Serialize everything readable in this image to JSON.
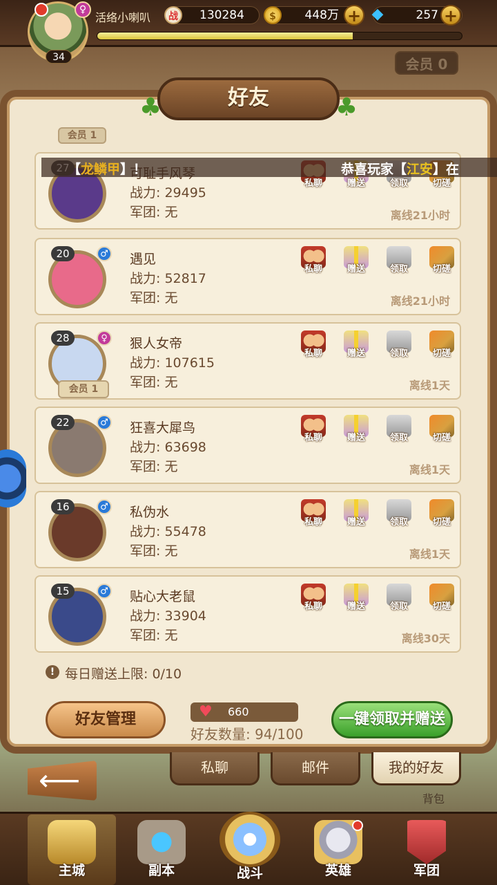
{
  "header": {
    "player_name": "活络小喇叭",
    "level": "34",
    "gender_symbol": "♀",
    "power_icon": "战",
    "power": "130284",
    "gold": "448万",
    "gems": "257",
    "plus_symbol": "+",
    "exp_progress": 0.7,
    "vip_label": "会员 0"
  },
  "panel": {
    "title": "好友"
  },
  "marquee": {
    "left_prefix": "【",
    "left_name": "龙鳞甲",
    "left_suffix": "】！",
    "right_prefix": "恭喜玩家【",
    "right_name": "江安",
    "right_suffix": "】在"
  },
  "actions": {
    "chat": "私聊",
    "gift": "赠送",
    "claim": "领取",
    "duel": "切磋"
  },
  "partial_vip": "会员 1",
  "friends": [
    {
      "level": "27",
      "name": "可耻手风琴",
      "power": "战力: 29495",
      "legion": "军团: 无",
      "status": "离线21小时",
      "gender": "",
      "vip": "",
      "portrait_color": "#5a3a8a"
    },
    {
      "level": "20",
      "name": "遇见",
      "power": "战力: 52817",
      "legion": "军团: 无",
      "status": "离线21小时",
      "gender": "♂",
      "vip": "",
      "portrait_color": "#e86a8a"
    },
    {
      "level": "28",
      "name": "狠人女帝",
      "power": "战力: 107615",
      "legion": "军团: 无",
      "status": "离线1天",
      "gender": "♀",
      "vip": "会员 1",
      "portrait_color": "#c8d8f0"
    },
    {
      "level": "22",
      "name": "狂喜大犀鸟",
      "power": "战力: 63698",
      "legion": "军团: 无",
      "status": "离线1天",
      "gender": "♂",
      "vip": "",
      "portrait_color": "#8a7a70"
    },
    {
      "level": "16",
      "name": "私伪水",
      "power": "战力: 55478",
      "legion": "军团: 无",
      "status": "离线1天",
      "gender": "♂",
      "vip": "",
      "portrait_color": "#6a3a2a"
    },
    {
      "level": "15",
      "name": "贴心大老鼠",
      "power": "战力: 33904",
      "legion": "军团: 无",
      "status": "离线30天",
      "gender": "♂",
      "vip": "",
      "portrait_color": "#3a4a8a"
    }
  ],
  "footer": {
    "daily_icon": "!",
    "daily_limit": "每日赠送上限: 0/10",
    "manage_button": "好友管理",
    "hearts": "660",
    "friend_count": "好友数量: 94/100",
    "claim_all_button": "一键领取并赠送"
  },
  "tabs": {
    "chat": "私聊",
    "mail": "邮件",
    "my_friends": "我的好友"
  },
  "bag_label": "背包",
  "nav": {
    "main_city": "主城",
    "dungeon": "副本",
    "battle": "战斗",
    "hero": "英雄",
    "legion": "军团"
  },
  "colors": {
    "accent_brown": "#7b5330",
    "claim_green": "#3aa02a",
    "heart_red": "#f04a5a",
    "text_dark": "#5a3a22"
  }
}
